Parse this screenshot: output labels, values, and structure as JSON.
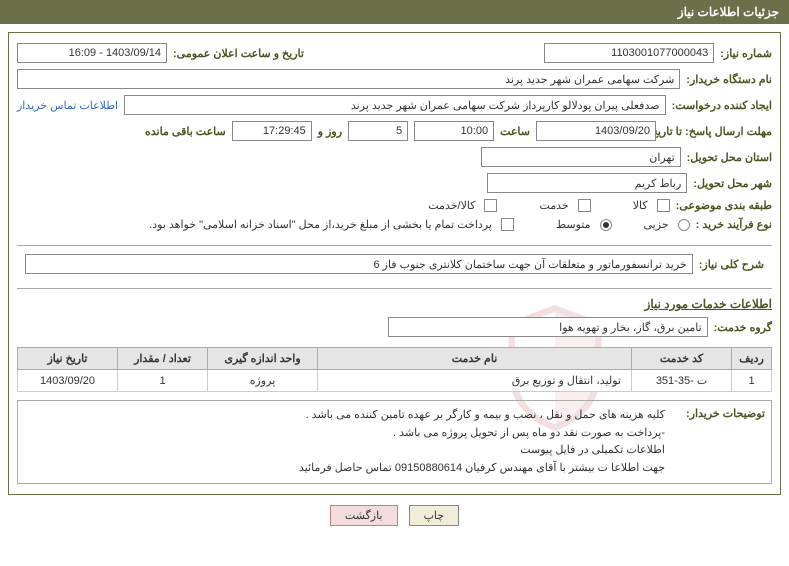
{
  "title": "جزئیات اطلاعات نیاز",
  "fields": {
    "need_no_label": "شماره نیاز:",
    "need_no": "1103001077000043",
    "announce_label": "تاریخ و ساعت اعلان عمومی:",
    "announce": "1403/09/14 - 16:09",
    "buyer_label": "نام دستگاه خریدار:",
    "buyer": "شرکت سهامی عمران شهر جدید پرند",
    "requester_label": "ایجاد کننده درخواست:",
    "requester": "صدفعلی پیران پودلالو کارپرداز شرکت سهامی عمران شهر جدید پرند",
    "contact_link": "اطلاعات تماس خریدار",
    "deadline_label": "مهلت ارسال پاسخ: تا تاریخ:",
    "deadline_date": "1403/09/20",
    "time_word": "ساعت",
    "deadline_time": "10:00",
    "days": "5",
    "days_word": "روز و",
    "remaining_time": "17:29:45",
    "remaining_word": "ساعت باقی مانده",
    "province_label": "استان محل تحویل:",
    "province": "تهران",
    "city_label": "شهر محل تحویل:",
    "city": "رباط کریم",
    "category_label": "طبقه بندی موضوعی:",
    "cat_goods": "کالا",
    "cat_service": "خدمت",
    "cat_goods_service": "کالا/خدمت",
    "process_label": "نوع فرآیند خرید :",
    "process_partial": "جزیی",
    "process_medium": "متوسط",
    "payment_note": "پرداخت تمام یا بخشی از مبلغ خرید،از محل \"اسناد خزانه اسلامی\" خواهد بود."
  },
  "desc": {
    "label": "شرح کلی نیاز:",
    "text": "خرید ترانسفورماتور و متعلقات آن جهت ساختمان کلانتری جنوب فاز 6"
  },
  "services": {
    "title": "اطلاعات خدمات مورد نیاز",
    "group_label": "گروه خدمت:",
    "group": "تامین برق، گاز، بخار و تهویه هوا"
  },
  "table": {
    "headers": {
      "row": "ردیف",
      "code": "کد خدمت",
      "name": "نام خدمت",
      "unit": "واحد اندازه گیری",
      "qty": "تعداد / مقدار",
      "date": "تاریخ نیاز"
    },
    "rows": [
      {
        "row": "1",
        "code": "ت -35-351",
        "name": "تولید، انتقال و توزیع برق",
        "unit": "پروژه",
        "qty": "1",
        "date": "1403/09/20"
      }
    ]
  },
  "notes": {
    "label": "توضیحات خریدار:",
    "text": "کلیه هزینه های حمل و نقل ، نصب و بیمه و کارگر بر عهده تامین کننده  می باشد .\n-پرداخت به صورت نقد دو ماه پس از تحویل پروژه  می باشد .\nاطلاعات تکمیلی در فایل پیوست\nجهت اطلاعا ت بیشتر با آقای مهندس کرفیان  09150880614 تماس حاصل فرمائید"
  },
  "buttons": {
    "print": "چاپ",
    "back": "بازگشت"
  },
  "watermark": "AriaTender.net"
}
